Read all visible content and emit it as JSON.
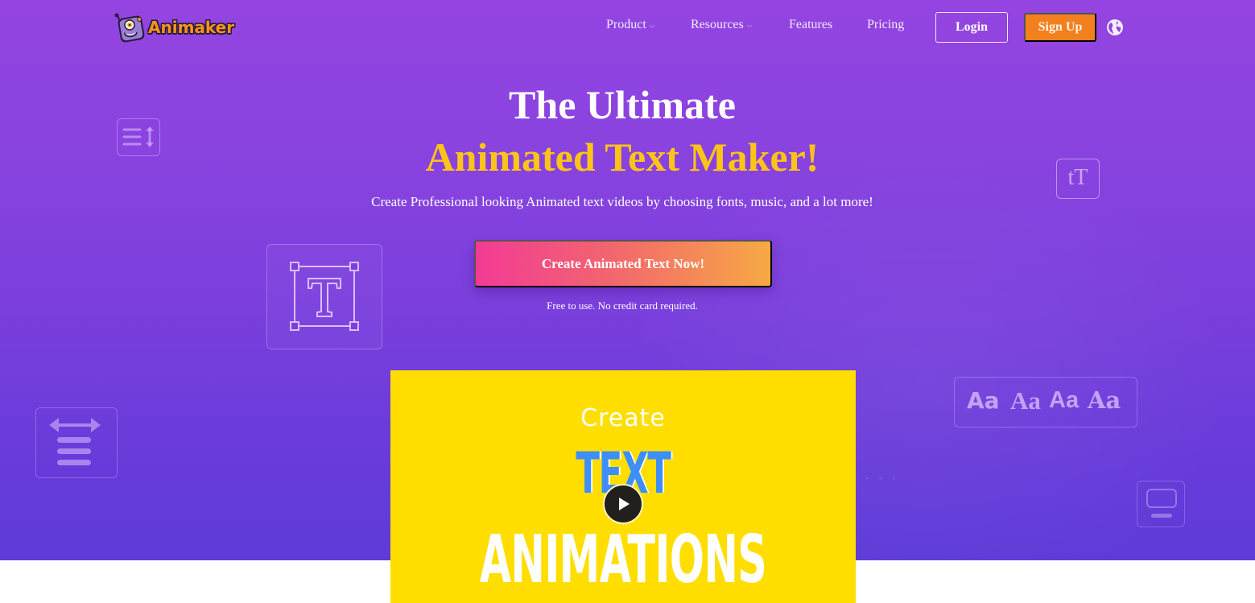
{
  "header": {
    "logo_text": "Animaker",
    "nav": [
      {
        "label": "Product",
        "has_dropdown": true
      },
      {
        "label": "Resources",
        "has_dropdown": true
      },
      {
        "label": "Features",
        "has_dropdown": false
      },
      {
        "label": "Pricing",
        "has_dropdown": false
      }
    ],
    "login_label": "Login",
    "signup_label": "Sign Up",
    "language_icon": "globe-icon"
  },
  "hero": {
    "title_line1": "The Ultimate",
    "title_line2": "Animated Text Maker!",
    "subtitle": "Create Professional looking Animated text videos by choosing fonts, music, and a lot more!",
    "cta_label": "Create Animated Text Now!",
    "cta_note": "Free to use. No credit card required."
  },
  "decorations": {
    "font_samples": [
      "Aa",
      "Aa",
      "Aa",
      "Aa"
    ],
    "text_size_glyph": "tT"
  },
  "video": {
    "line1": "Create",
    "line2": "TEXT",
    "line3": "ANIMATIONS",
    "play_icon": "play-icon"
  },
  "colors": {
    "hero_top": "#9444e1",
    "hero_bottom": "#5e3bd8",
    "headline_accent": "#fcc419",
    "signup": "#f3801f",
    "cta_start": "#f33a96",
    "cta_end": "#f7a944",
    "video_bg": "#ffde00",
    "video_text_blue": "#3d8ef7"
  }
}
